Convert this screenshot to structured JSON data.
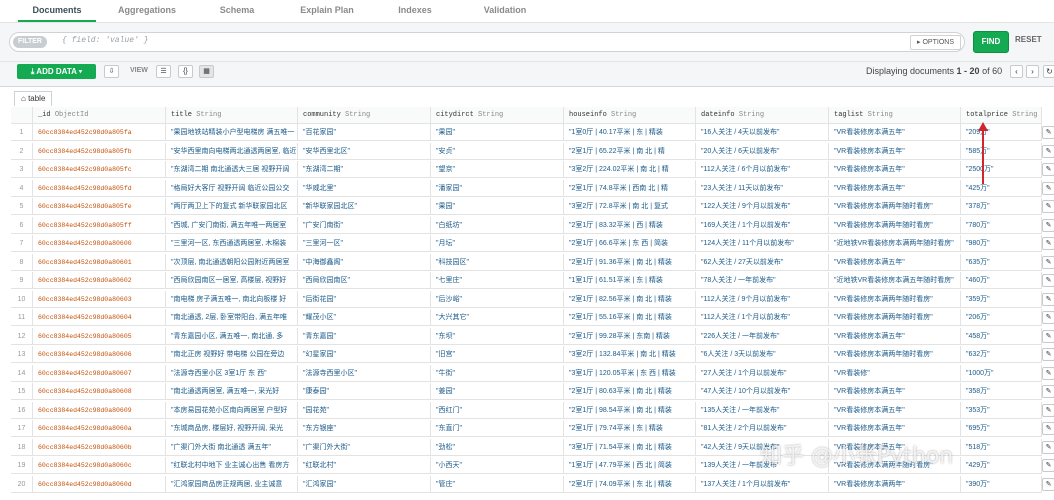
{
  "tabs": [
    "Documents",
    "Aggregations",
    "Schema",
    "Explain Plan",
    "Indexes",
    "Validation"
  ],
  "filter": {
    "pill": "FILTER",
    "placeholder": "{ field: 'value' }",
    "options": "▸ OPTIONS",
    "find": "FIND",
    "reset": "RESET"
  },
  "toolbar": {
    "add_data": "ADD DATA ▾",
    "view_label": "VIEW",
    "paging_prefix": "Displaying documents ",
    "paging_range": "1 - 20",
    "paging_suffix": " of 60"
  },
  "table_tab": "table",
  "headers": [
    {
      "name": "_id",
      "type": "ObjectId"
    },
    {
      "name": "title",
      "type": "String"
    },
    {
      "name": "community",
      "type": "String"
    },
    {
      "name": "citydirct",
      "type": "String"
    },
    {
      "name": "houseinfo",
      "type": "String"
    },
    {
      "name": "dateinfo",
      "type": "String"
    },
    {
      "name": "taglist",
      "type": "String"
    },
    {
      "name": "totalprice",
      "type": "String"
    }
  ],
  "rows": [
    [
      "1",
      "60cc8384ed452c98d0a805fa",
      "\"果园地铁站精装小户型电梯房 满五唯一",
      "\"百花家园\"",
      "\"果园\"",
      "\"1室0厅 | 40.17平米 | 东 | 精装",
      "\"16人关注 / 4天以前发布\"",
      "\"VR看装修房本满五年\"",
      "\"209万\""
    ],
    [
      "2",
      "60cc8384ed452c98d0a805fb",
      "\"安华西里南向电梯两北通透两居室, 临近",
      "\"安华西里北区\"",
      "\"安贞\"",
      "\"2室1厅 | 65.22平米 | 南 北 | 精",
      "\"20人关注 / 6天以前发布\"",
      "\"VR看装修房本满五年\"",
      "\"585万\""
    ],
    [
      "3",
      "60cc8384ed452c98d0a805fc",
      "\"东湖湾二期 南北通透大三居 视野开阔",
      "\"东湖湾二期\"",
      "\"望京\"",
      "\"3室2厅 | 224.02平米 | 南 北 | 精",
      "\"112人关注 / 6个月以前发布\"",
      "\"VR看装修房本满五年\"",
      "\"2500万\""
    ],
    [
      "4",
      "60cc8384ed452c98d0a805fd",
      "\"格局好大客厅 视野开阔 临近公园公交",
      "\"华威北里\"",
      "\"潘家园\"",
      "\"2室1厅 | 74.8平米 | 西南 北 | 精",
      "\"23人关注 / 11天以前发布\"",
      "\"VR看装修房本满五年\"",
      "\"425万\""
    ],
    [
      "5",
      "60cc8384ed452c98d0a805fe",
      "\"两厅两卫上下的复式 新华联家园北区",
      "\"新华联家园北区\"",
      "\"果园\"",
      "\"3室2厅 | 72.8平米 | 南 北 | 复式",
      "\"122人关注 / 9个月以前发布\"",
      "\"VR看装修房本满两年随时看房\"",
      "\"378万\""
    ],
    [
      "6",
      "60cc8384ed452c98d0a805ff",
      "\"西城, 广安门南街, 满五年唯一两居室",
      "\"广安门南街\"",
      "\"白纸坊\"",
      "\"2室1厅 | 83.32平米 | 西 | 精装",
      "\"169人关注 / 1个月以前发布\"",
      "\"VR看装修房本满两年随时看房\"",
      "\"780万\""
    ],
    [
      "7",
      "60cc8384ed452c98d0a80600",
      "\"三里河一区, 东西通透两居室, 木棉装",
      "\"三里河一区\"",
      "\"月坛\"",
      "\"2室1厅 | 66.6平米 | 东 西 | 简装",
      "\"124人关注 / 11个月以前发布\"",
      "\"近地铁VR看装修房本满两年随时看房\"",
      "\"980万\""
    ],
    [
      "8",
      "60cc8384ed452c98d0a80601",
      "\"次顶层, 南北通透朝阳公园附近两居室",
      "\"中海御鑫阁\"",
      "\"科技园区\"",
      "\"2室1厅 | 91.36平米 | 南 北 | 精装",
      "\"62人关注 / 27天以前发布\"",
      "\"VR看装修房本满五年\"",
      "\"635万\""
    ],
    [
      "9",
      "60cc8384ed452c98d0a80602",
      "\"西局欣园南区一居室, 高楼层, 视野好",
      "\"西局欣园南区\"",
      "\"七里庄\"",
      "\"1室1厅 | 61.51平米 | 东 | 精装",
      "\"78人关注 / 一年前发布\"",
      "\"近地铁VR看装修房本满五年随时看房\"",
      "\"460万\""
    ],
    [
      "10",
      "60cc8384ed452c98d0a80603",
      "\"南电梯 房子满五唯一, 南北向板楼 好",
      "\"后街花园\"",
      "\"后沙峪\"",
      "\"2室1厅 | 82.56平米 | 南 北 | 精装",
      "\"112人关注 / 9个月以前发布\"",
      "\"VR看装修房本满两年随时看房\"",
      "\"359万\""
    ],
    [
      "11",
      "60cc8384ed452c98d0a80604",
      "\"南北通透, 2层, 卧室带阳台, 满五年唯",
      "\"耀茂小区\"",
      "\"大兴其它\"",
      "\"2室1厅 | 55.16平米 | 南 北 | 精装",
      "\"112人关注 / 1个月以前发布\"",
      "\"VR看装修房本满两年随时看房\"",
      "\"206万\""
    ],
    [
      "12",
      "60cc8384ed452c98d0a80605",
      "\"青东嘉园小区, 满五唯一, 南北通, 多",
      "\"青东嘉园\"",
      "\"东坝\"",
      "\"2室1厅 | 99.28平米 | 东南 | 精装",
      "\"226人关注 / 一年前发布\"",
      "\"VR看装修房本满五年\"",
      "\"458万\""
    ],
    [
      "13",
      "60cc8384ed452c98d0a80606",
      "\"南北正房 视野好 带电梯 公园在旁边",
      "\"幻星家园\"",
      "\"旧宫\"",
      "\"3室2厅 | 132.84平米 | 南 北 | 精装",
      "\"6人关注 / 3天以前发布\"",
      "\"VR看装修房本满两年随时看房\"",
      "\"632万\""
    ],
    [
      "14",
      "60cc8384ed452c98d0a80607",
      "\"法源寺西里小区 3室1厅 东 西\"",
      "\"法源寺西里小区\"",
      "\"牛街\"",
      "\"3室1厅 | 120.05平米 | 东 西 | 精装",
      "\"27人关注 / 1个月以前发布\"",
      "\"VR看装修\"",
      "\"1000万\""
    ],
    [
      "15",
      "60cc8384ed452c98d0a80608",
      "\"南北通透两居室, 满五唯一, 采光好",
      "\"康泰园\"",
      "\"姜园\"",
      "\"2室1厅 | 80.63平米 | 南 北 | 精装",
      "\"47人关注 / 10个月以前发布\"",
      "\"VR看装修房本满五年\"",
      "\"358万\""
    ],
    [
      "16",
      "60cc8384ed452c98d0a80609",
      "\"本房易园花苑小区南向两居室 户型好",
      "\"园花苑\"",
      "\"西红门\"",
      "\"2室1厅 | 98.54平米 | 南 北 | 精装",
      "\"135人关注 / 一年前发布\"",
      "\"VR看装修房本满五年\"",
      "\"353万\""
    ],
    [
      "17",
      "60cc8384ed452c98d0a8060a",
      "\"东城商品房, 楼层好, 视野开阔, 采光",
      "\"东方银座\"",
      "\"东直门\"",
      "\"2室1厅 | 79.74平米 | 东 | 精装",
      "\"81人关注 / 2个月以前发布\"",
      "\"VR看装修房本满五年\"",
      "\"695万\""
    ],
    [
      "18",
      "60cc8384ed452c98d0a8060b",
      "\"广渠门外大街 南北通透 满五年\"",
      "\"广渠门外大街\"",
      "\"劲松\"",
      "\"3室1厅 | 71.54平米 | 南 北 | 精装",
      "\"42人关注 / 9天以前发布\"",
      "\"VR看装修房本满五年\"",
      "\"518万\""
    ],
    [
      "19",
      "60cc8384ed452c98d0a8060c",
      "\"红联北村中地下 业主诚心出售 看房方",
      "\"红联北村\"",
      "\"小西天\"",
      "\"1室1厅 | 47.79平米 | 西 北 | 简装",
      "\"139人关注 / 一年前发布\"",
      "\"VR看装修房本满两年随时看房\"",
      "\"429万\""
    ],
    [
      "20",
      "60cc8384ed452c98d0a8060d",
      "\"汇鸿家园商品房正规两居, 业主诚意",
      "\"汇鸿家园\"",
      "\"管庄\"",
      "\"2室1厅 | 74.09平米 | 东 北 | 精装",
      "\"137人关注 / 1个月以前发布\"",
      "\"VR看装修房本满两年\"",
      "\"390万\""
    ]
  ],
  "watermark": "知乎 @小张Python",
  "colors": {
    "accent": "#13aa52",
    "objectid": "#c5510a",
    "annotation": "#d0272f"
  }
}
